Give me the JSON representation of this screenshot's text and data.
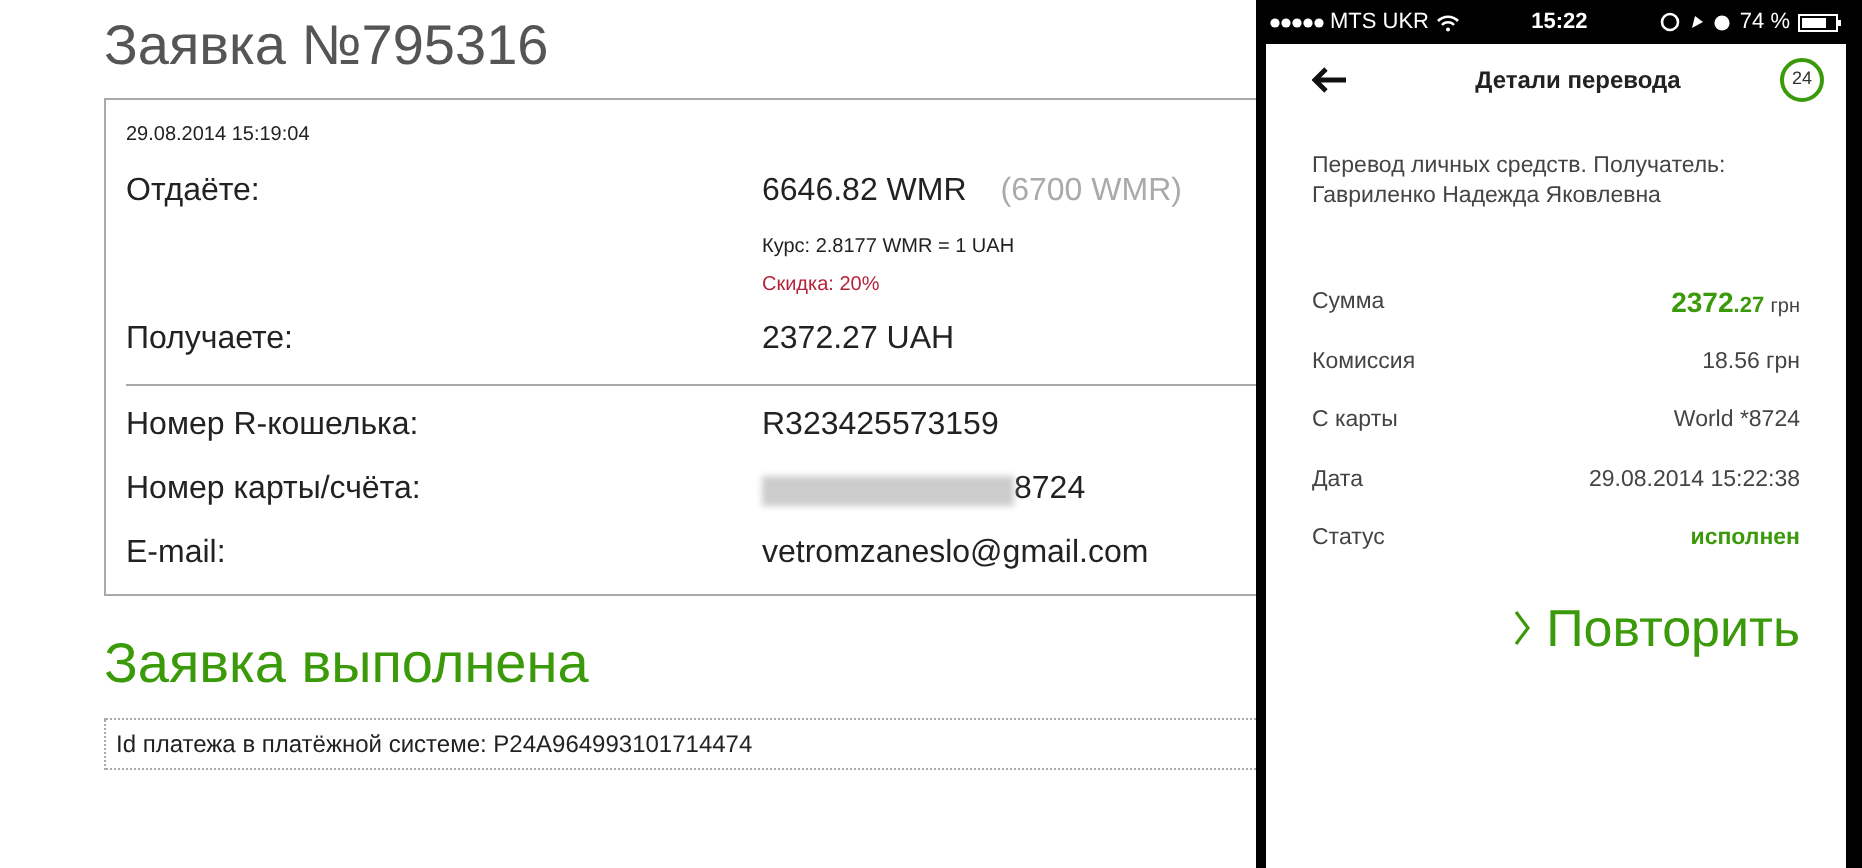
{
  "page": {
    "title": "Заявка №795316",
    "order": {
      "date": "29.08.2014 15:19:04",
      "give": {
        "label": "Отдаёте:",
        "value": "6646.82 WMR",
        "original": "(6700 WMR)",
        "rate": "Курс: 2.8177 WMR = 1 UAH",
        "discount": "Скидка: 20%"
      },
      "receive": {
        "label": "Получаете:",
        "value": "2372.27 UAH"
      },
      "details": [
        {
          "label": "Номер R-кошелька:",
          "value": "R323425573159",
          "masked": false
        },
        {
          "label": "Номер карты/счёта:",
          "value": "8724",
          "masked": true
        },
        {
          "label": "E-mail:",
          "value": "vetromzaneslo@gmail.com",
          "masked": false
        }
      ]
    },
    "status": "Заявка выполнена",
    "payment_id": "Id платежа в платёжной системе: P24A964993101714474"
  },
  "phone": {
    "status_bar": {
      "carrier": "MTS UKR",
      "time": "15:22",
      "battery": "74 %"
    },
    "header": {
      "title": "Детали перевода",
      "badge": "24"
    },
    "description": "Перевод личных средств. Получатель: Гавриленко Надежда Яковлевна",
    "rows": [
      {
        "kind": "amount",
        "label": "Сумма",
        "whole": "2372",
        "fraction": ".27",
        "currency": "грн"
      },
      {
        "kind": "text",
        "label": "Комиссия",
        "value": "18.56 грн"
      },
      {
        "kind": "text",
        "label": "С карты",
        "value": "World *8724"
      },
      {
        "kind": "text",
        "label": "Дата",
        "value": "29.08.2014 15:22:38"
      },
      {
        "kind": "status",
        "label": "Статус",
        "value": "исполнен"
      }
    ],
    "repeat_button": "Повторить"
  }
}
